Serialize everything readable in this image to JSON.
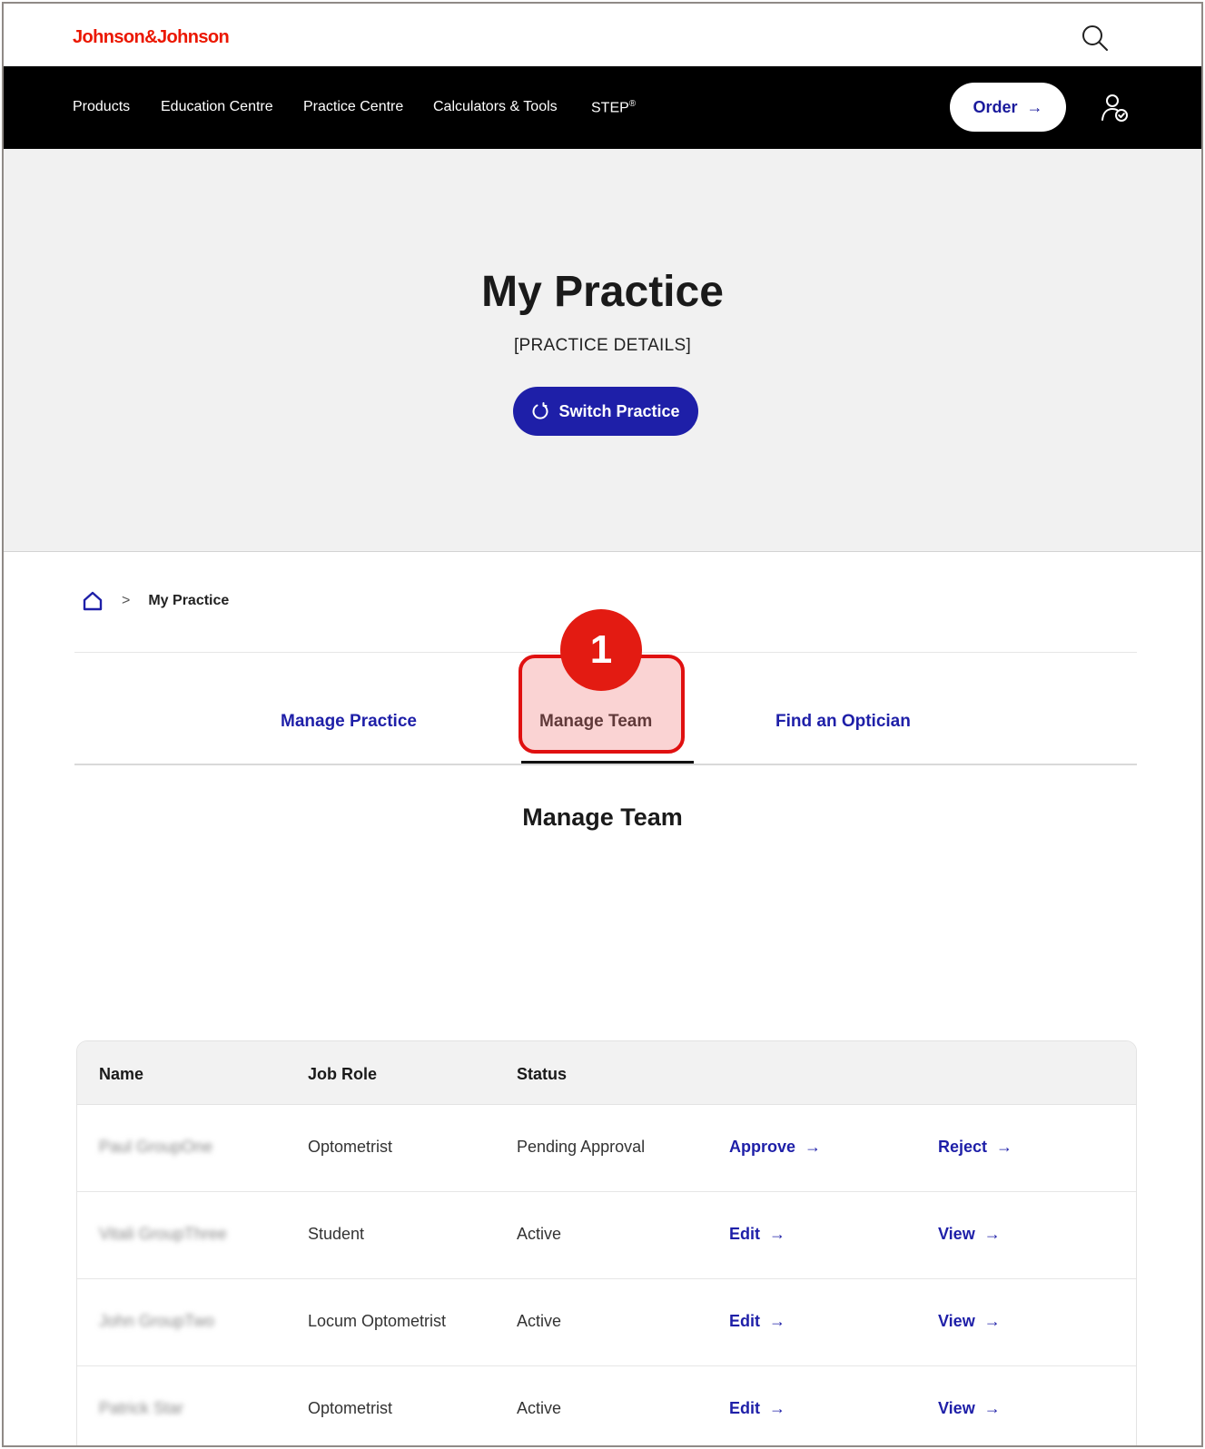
{
  "header": {
    "logo": "Johnson&Johnson",
    "search_icon": "search-icon",
    "account_icon": "user-check-icon"
  },
  "nav": {
    "items": [
      "Products",
      "Education Centre",
      "Practice Centre",
      "Calculators & Tools"
    ],
    "step_label": "STEP",
    "step_sup": "®",
    "order_label": "Order",
    "order_arrow": "→"
  },
  "hero": {
    "title": "My Practice",
    "subtitle": "[PRACTICE DETAILS]",
    "switch_label": "Switch Practice",
    "switch_icon": "refresh-icon"
  },
  "breadcrumb": {
    "home_icon": "home-icon",
    "separator": ">",
    "current": "My Practice"
  },
  "tabs": {
    "items": [
      "Manage Practice",
      "Manage Team",
      "Find an Optician"
    ],
    "active_index": 1
  },
  "callout": {
    "number": "1"
  },
  "section": {
    "title": "Manage Team"
  },
  "table": {
    "headers": [
      "Name",
      "Job Role",
      "Status"
    ],
    "rows": [
      {
        "name": "Paul GroupOne",
        "role": "Optometrist",
        "status": "Pending Approval",
        "action1": "Approve",
        "action2": "Reject"
      },
      {
        "name": "Vitali GroupThree",
        "role": "Student",
        "status": "Active",
        "action1": "Edit",
        "action2": "View"
      },
      {
        "name": "John GroupTwo",
        "role": "Locum Optometrist",
        "status": "Active",
        "action1": "Edit",
        "action2": "View"
      },
      {
        "name": "Patrick Star",
        "role": "Optometrist",
        "status": "Active",
        "action1": "Edit",
        "action2": "View"
      }
    ],
    "arrow": "→"
  },
  "colors": {
    "brand_red": "#eb1700",
    "link_blue": "#1e1fa8",
    "callout_red": "#e31b12"
  }
}
